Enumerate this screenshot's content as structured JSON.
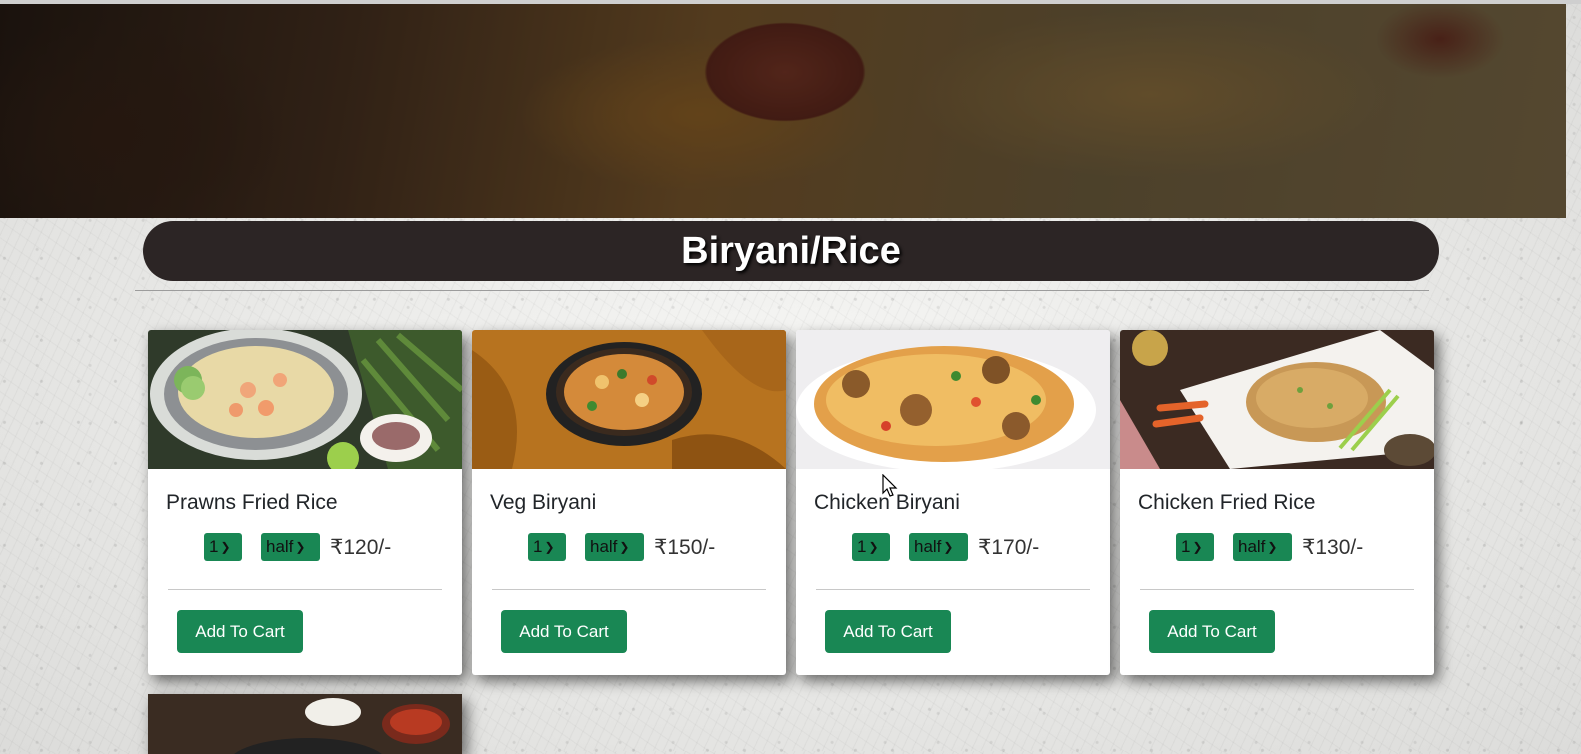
{
  "section": {
    "title": "Biryani/Rice"
  },
  "items": [
    {
      "name": "Prawns Fried Rice",
      "qty": "1",
      "size": "half",
      "price": "₹120/-",
      "button": "Add To Cart"
    },
    {
      "name": "Veg Biryani",
      "qty": "1",
      "size": "half",
      "price": "₹150/-",
      "button": "Add To Cart"
    },
    {
      "name": "Chicken Biryani",
      "qty": "1",
      "size": "half",
      "price": "₹170/-",
      "button": "Add To Cart"
    },
    {
      "name": "Chicken Fried Rice",
      "qty": "1",
      "size": "half",
      "price": "₹130/-",
      "button": "Add To Cart"
    }
  ],
  "colors": {
    "accent": "#198754",
    "title_bar": "#2c2525"
  },
  "icons": {
    "dropdown": "chevron-down-icon",
    "cursor": "mouse-cursor-icon"
  }
}
